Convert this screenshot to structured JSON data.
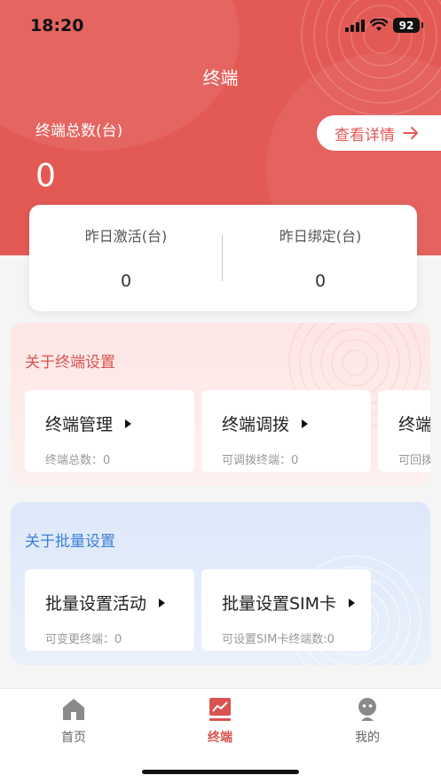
{
  "status_bar": {
    "time": "18:20",
    "battery": "92"
  },
  "header": {
    "title": "终端",
    "total_label": "终端总数(台)",
    "total_value": "0",
    "detail_button": "查看详情"
  },
  "stats": [
    {
      "label": "昨日激活(台)",
      "value": "0"
    },
    {
      "label": "昨日绑定(台)",
      "value": "0"
    }
  ],
  "terminal_section": {
    "title": "关于终端设置",
    "cards": [
      {
        "title": "终端管理",
        "sub": "终端总数：0"
      },
      {
        "title": "终端调拨",
        "sub": "可调拨终端：0"
      },
      {
        "title": "终端",
        "sub": "可回拨"
      }
    ]
  },
  "batch_section": {
    "title": "关于批量设置",
    "cards": [
      {
        "title": "批量设置活动",
        "sub": "可变更终端：0"
      },
      {
        "title": "批量设置SIM卡",
        "sub": "可设置SIM卡终端数:0"
      }
    ]
  },
  "nav": [
    {
      "label": "首页",
      "icon": "home-icon"
    },
    {
      "label": "终端",
      "icon": "chart-icon",
      "active": true
    },
    {
      "label": "我的",
      "icon": "profile-icon"
    }
  ],
  "colors": {
    "brand": "#e35a55",
    "blue_accent": "#3c7ed6"
  }
}
